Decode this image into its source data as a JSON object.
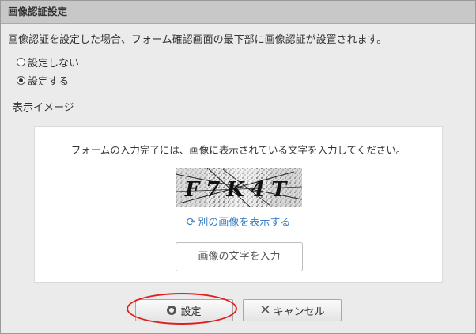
{
  "dialog": {
    "title": "画像認証設定",
    "description": "画像認証を設定した場合、フォーム確認画面の最下部に画像認証が設置されます。",
    "options": [
      {
        "label": "設定しない",
        "checked": false
      },
      {
        "label": "設定する",
        "checked": true
      }
    ],
    "preview_label": "表示イメージ"
  },
  "preview": {
    "instruction": "フォームの入力完了には、画像に表示されている文字を入力してください。",
    "captcha_text": "F7K4T",
    "refresh_label": "別の画像を表示する",
    "refresh_icon": "refresh-icon",
    "input_placeholder": "画像の文字を入力"
  },
  "buttons": {
    "set_label": "設定",
    "set_icon": "circle-ring-icon",
    "cancel_label": "キャンセル",
    "cancel_icon": "close-x-icon"
  },
  "colors": {
    "accent_link": "#3a7fc1",
    "highlight_ring": "#e01e1e",
    "title_bar": "#c8c8c8",
    "panel_bg": "#ebebeb"
  }
}
